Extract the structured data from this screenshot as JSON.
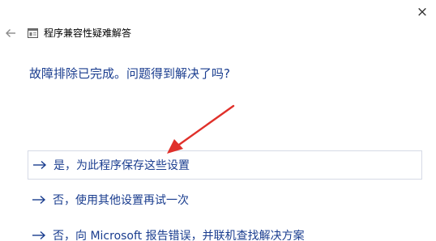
{
  "window": {
    "title": "程序兼容性疑难解答",
    "close_glyph": "×"
  },
  "main": {
    "question": "故障排除已完成。问题得到解决了吗?",
    "options": [
      {
        "label": "是，为此程序保存这些设置"
      },
      {
        "label": "否，使用其他设置再试一次"
      },
      {
        "label": "否，向 Microsoft 报告错误，并联机查找解决方案"
      }
    ]
  },
  "colors": {
    "link_text": "#1a3d8f",
    "annotation_arrow": "#e0302a",
    "selected_border": "#d6dae6"
  },
  "icons": {
    "back": "back-arrow-icon",
    "app": "troubleshooter-app-icon",
    "option_arrow": "right-arrow-icon",
    "close": "close-icon"
  }
}
